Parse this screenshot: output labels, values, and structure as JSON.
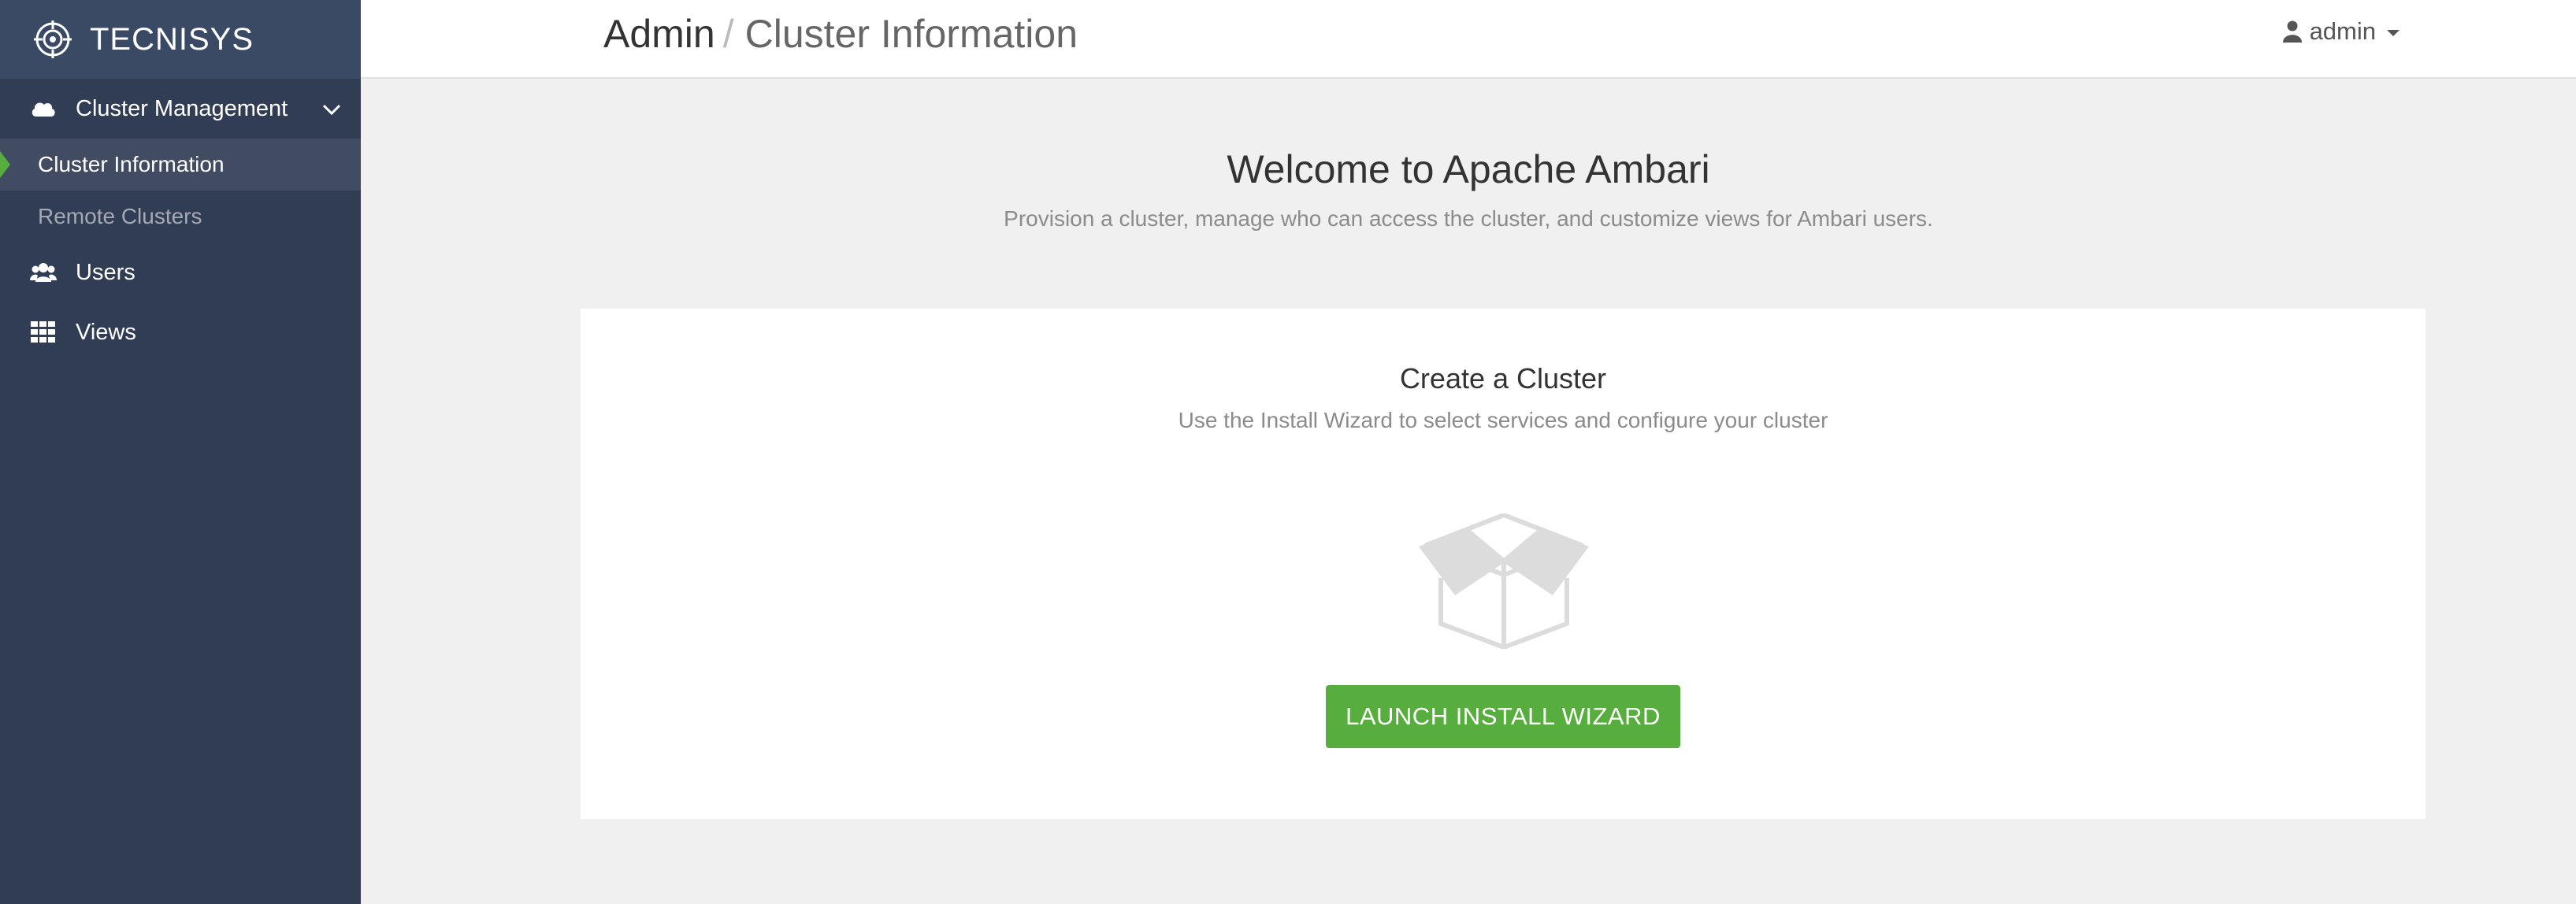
{
  "brand": {
    "name": "TECNISYS",
    "icon": "crosshair-logo-icon"
  },
  "sidebar": {
    "cluster_management": {
      "label": "Cluster Management",
      "icon": "cloud-icon",
      "expanded": true
    },
    "sub_items": [
      {
        "label": "Cluster Information",
        "active": true
      },
      {
        "label": "Remote Clusters",
        "active": false
      }
    ],
    "users": {
      "label": "Users",
      "icon": "users-icon"
    },
    "views": {
      "label": "Views",
      "icon": "grid-icon"
    }
  },
  "header": {
    "breadcrumb_root": "Admin",
    "breadcrumb_separator": "/",
    "breadcrumb_current": "Cluster Information",
    "user": "admin"
  },
  "main": {
    "welcome_title": "Welcome to Apache Ambari",
    "welcome_subtitle": "Provision a cluster, manage who can access the cluster, and customize views for Ambari users.",
    "card": {
      "title": "Create a Cluster",
      "subtitle": "Use the Install Wizard to select services and configure your cluster",
      "icon": "open-box-icon",
      "button_label": "LAUNCH INSTALL WIZARD"
    }
  },
  "colors": {
    "sidebar_bg": "#313d54",
    "brand_bg": "#3a4a64",
    "accent_green": "#58ad3f",
    "page_bg": "#f0f0f0"
  }
}
